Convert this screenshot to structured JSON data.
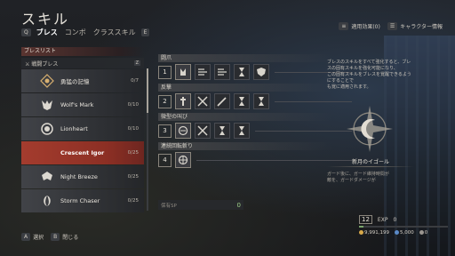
{
  "header": {
    "title": "スキル"
  },
  "tabs": {
    "left_key": "Q",
    "right_key": "E",
    "items": [
      "ブレス",
      "コンボ",
      "クラススキル"
    ],
    "active": 0
  },
  "top_right": {
    "effect_label": "適用効果(0)",
    "char_info_label": "キャラクター情報"
  },
  "list": {
    "header": "ブレスリスト",
    "subheader": "戦闘ブレス",
    "subheader_badge": "Z",
    "items": [
      {
        "name": "勇猛の記憶",
        "count": "0/7"
      },
      {
        "name": "Wolf's Mark",
        "count": "0/10"
      },
      {
        "name": "Lionheart",
        "count": "0/10"
      },
      {
        "name": "Crescent Igor",
        "count": "0/25"
      },
      {
        "name": "Night Breeze",
        "count": "0/25"
      },
      {
        "name": "Storm Chaser",
        "count": "0/25"
      }
    ],
    "selected_index": 3
  },
  "center": {
    "rows": [
      {
        "title": "闘爪",
        "num": "1"
      },
      {
        "title": "反撃",
        "num": "2"
      },
      {
        "title": "微型の叫び",
        "num": "3"
      },
      {
        "title": "連続回転斬り",
        "num": "4"
      }
    ],
    "footer_label": "保有SP",
    "footer_value": "0"
  },
  "info": {
    "desc": "ブレスのスキルをすべて強化すると、ブレスの固有スキルを強化可能になり、\nこの固有スキルをブレスを覚醒できるようにすることで\nも覚に適用されます。",
    "name": "新月のイゴール",
    "foot": "ガード後に、ガード維持時間が\n敵を、ガードダメージが"
  },
  "status": {
    "level": "12",
    "exp_label": "EXP",
    "exp_value": "0",
    "exp_fill": 0.05,
    "gold": "9,991,199",
    "crystal": "5,000",
    "other": "0"
  },
  "hints": {
    "select_key": "A",
    "select_label": "選択",
    "close_key": "B",
    "close_label": "閉じる"
  },
  "colors": {
    "accent": "#a43c2e",
    "panel": "#2a2c30"
  }
}
